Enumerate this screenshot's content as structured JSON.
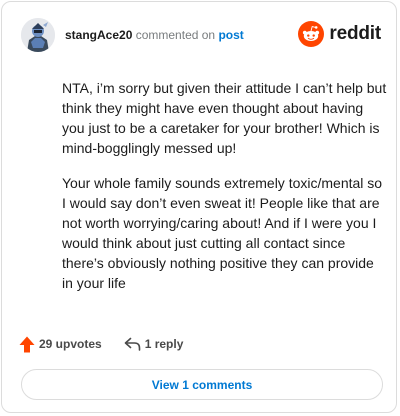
{
  "comment": {
    "username": "stangAce20",
    "action_text": "commented on",
    "post_link_text": "post",
    "paragraphs": [
      "NTA, i’m sorry but given their attitude I can’t help but think they might have even thought about having you just to be a caretaker for your brother! Which is mind-bogglingly messed up!",
      "Your whole family sounds extremely toxic/mental so I would say don’t even sweat it! People like that are not worth worrying/caring about! And if I were you I would think about just cutting all contact since there’s obviously nothing positive they can provide in your life"
    ],
    "upvotes_label": "29 upvotes",
    "reply_label": "1 reply",
    "view_comments_label": "View 1 comments"
  },
  "brand": {
    "logo_text": "reddit",
    "accent_color": "#ff4500",
    "link_color": "#0079d3"
  },
  "icons": {
    "avatar": "avatar",
    "logo": "reddit-snoo-icon",
    "upvote": "upvote-arrow-icon",
    "reply": "reply-arrow-icon"
  }
}
